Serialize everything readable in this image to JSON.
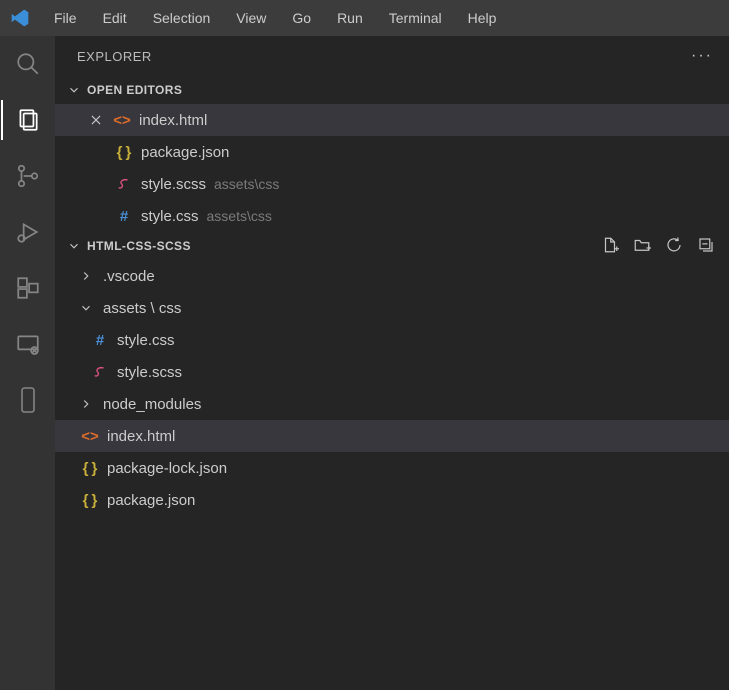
{
  "menu": {
    "items": [
      "File",
      "Edit",
      "Selection",
      "View",
      "Go",
      "Run",
      "Terminal",
      "Help"
    ]
  },
  "sidebar": {
    "title": "EXPLORER"
  },
  "openEditors": {
    "title": "OPEN EDITORS",
    "items": [
      {
        "name": "index.html",
        "icon": "html",
        "close": true,
        "sublabel": ""
      },
      {
        "name": "package.json",
        "icon": "json",
        "close": false,
        "sublabel": ""
      },
      {
        "name": "style.scss",
        "icon": "scss",
        "close": false,
        "sublabel": "assets\\css"
      },
      {
        "name": "style.css",
        "icon": "css",
        "close": false,
        "sublabel": "assets\\css"
      }
    ]
  },
  "workspace": {
    "title": "HTML-CSS-SCSS",
    "tree": {
      "vscode": ".vscode",
      "assets_css": "assets \\ css",
      "style_css": "style.css",
      "style_scss": "style.scss",
      "node_modules": "node_modules",
      "index_html": "index.html",
      "pkg_lock": "package-lock.json",
      "pkg": "package.json"
    }
  }
}
